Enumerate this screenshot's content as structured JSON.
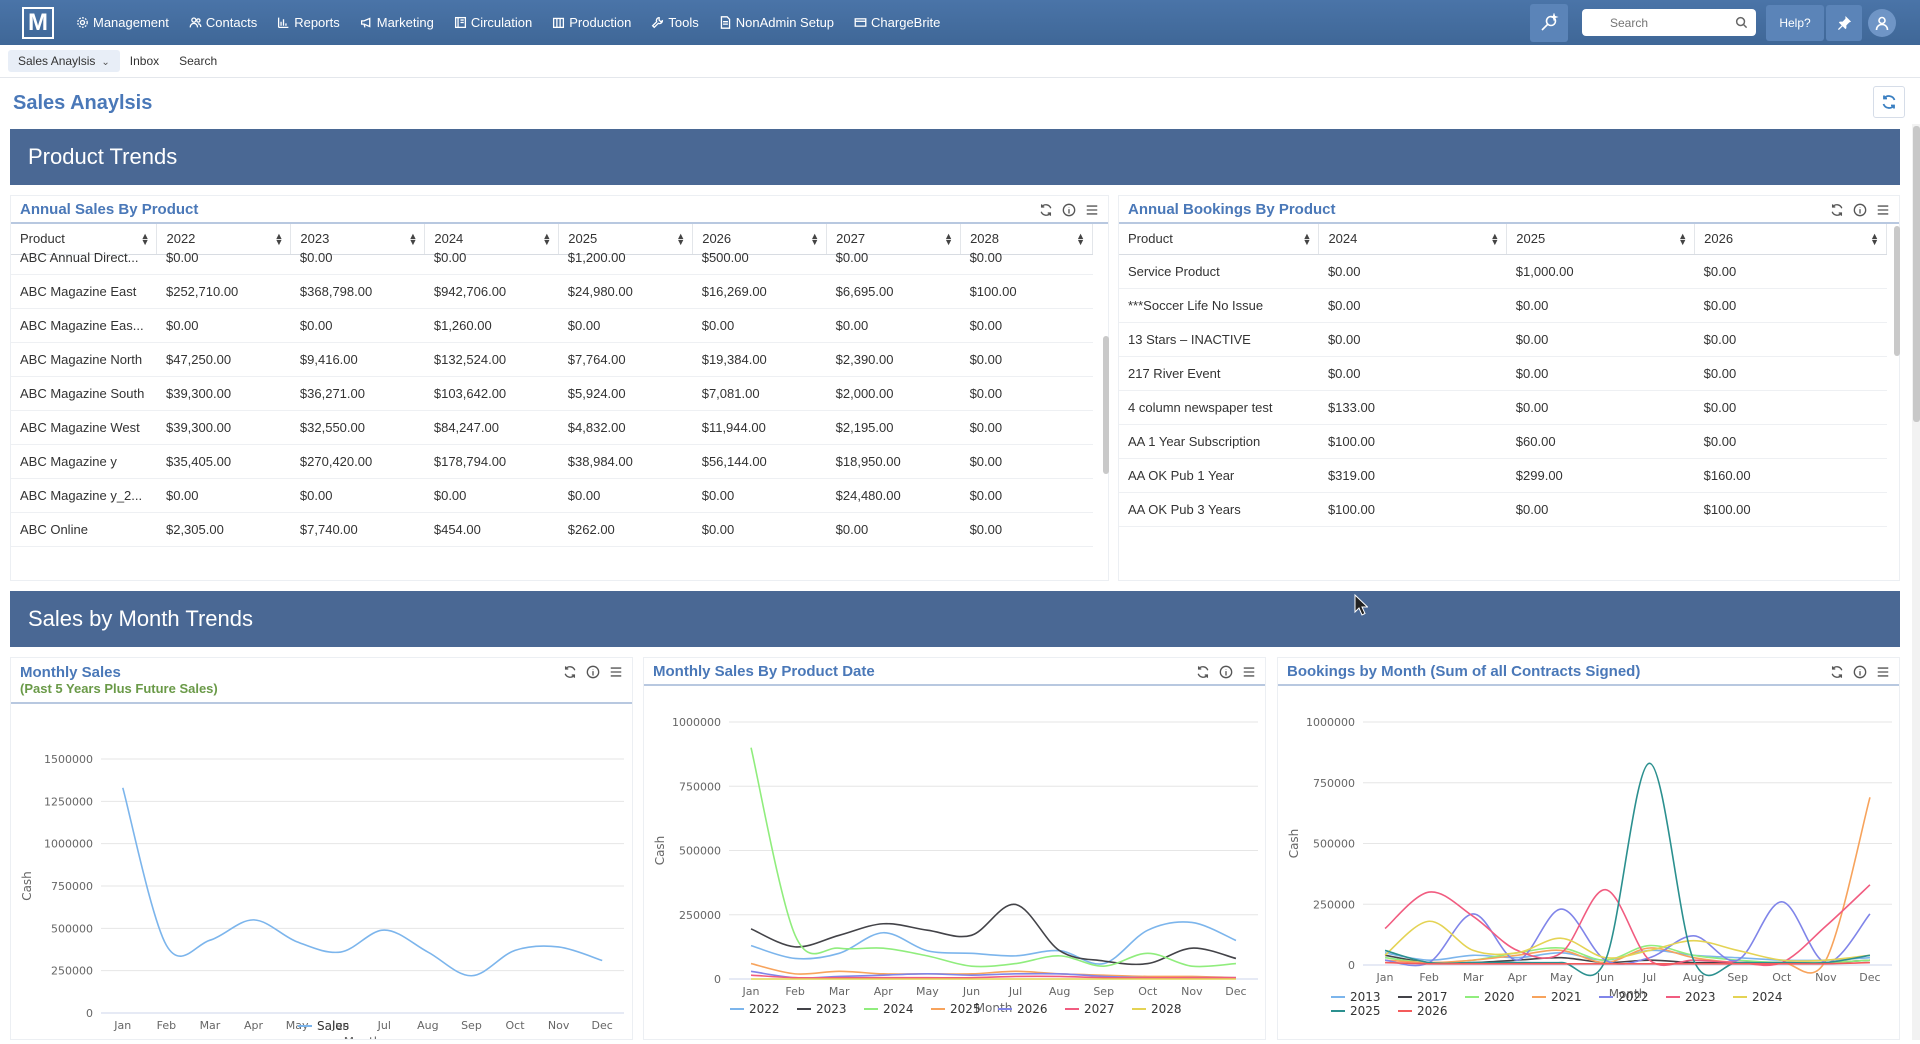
{
  "nav": {
    "logo": "M",
    "items": [
      {
        "label": "Management",
        "icon": "gear-icon"
      },
      {
        "label": "Contacts",
        "icon": "people-icon"
      },
      {
        "label": "Reports",
        "icon": "bar-chart-icon"
      },
      {
        "label": "Marketing",
        "icon": "megaphone-icon"
      },
      {
        "label": "Circulation",
        "icon": "book-icon"
      },
      {
        "label": "Production",
        "icon": "building-icon"
      },
      {
        "label": "Tools",
        "icon": "wrench-icon"
      },
      {
        "label": "NonAdmin Setup",
        "icon": "document-icon"
      },
      {
        "label": "ChargeBrite",
        "icon": "card-icon"
      }
    ],
    "search_placeholder": "Search",
    "help_label": "Help?"
  },
  "tabs": {
    "active": "Sales Anaylsis",
    "inbox": "Inbox",
    "search": "Search"
  },
  "page_title": "Sales Anaylsis",
  "sections": {
    "product_trends": "Product Trends",
    "sales_by_month": "Sales by Month Trends"
  },
  "annual_sales": {
    "title": "Annual Sales By Product",
    "columns": [
      "Product",
      "2022",
      "2023",
      "2024",
      "2025",
      "2026",
      "2027",
      "2028"
    ],
    "rows": [
      [
        "ABC Annual Direct...",
        "$0.00",
        "$0.00",
        "$0.00",
        "$1,200.00",
        "$500.00",
        "$0.00",
        "$0.00"
      ],
      [
        "ABC Magazine East",
        "$252,710.00",
        "$368,798.00",
        "$942,706.00",
        "$24,980.00",
        "$16,269.00",
        "$6,695.00",
        "$100.00"
      ],
      [
        "ABC Magazine Eas...",
        "$0.00",
        "$0.00",
        "$1,260.00",
        "$0.00",
        "$0.00",
        "$0.00",
        "$0.00"
      ],
      [
        "ABC Magazine North",
        "$47,250.00",
        "$9,416.00",
        "$132,524.00",
        "$7,764.00",
        "$19,384.00",
        "$2,390.00",
        "$0.00"
      ],
      [
        "ABC Magazine South",
        "$39,300.00",
        "$36,271.00",
        "$103,642.00",
        "$5,924.00",
        "$7,081.00",
        "$2,000.00",
        "$0.00"
      ],
      [
        "ABC Magazine West",
        "$39,300.00",
        "$32,550.00",
        "$84,247.00",
        "$4,832.00",
        "$11,944.00",
        "$2,195.00",
        "$0.00"
      ],
      [
        "ABC Magazine y",
        "$35,405.00",
        "$270,420.00",
        "$178,794.00",
        "$38,984.00",
        "$56,144.00",
        "$18,950.00",
        "$0.00"
      ],
      [
        "ABC Magazine y_2...",
        "$0.00",
        "$0.00",
        "$0.00",
        "$0.00",
        "$0.00",
        "$24,480.00",
        "$0.00"
      ],
      [
        "ABC Online",
        "$2,305.00",
        "$7,740.00",
        "$454.00",
        "$262.00",
        "$0.00",
        "$0.00",
        "$0.00"
      ]
    ]
  },
  "annual_bookings": {
    "title": "Annual Bookings By Product",
    "columns": [
      "Product",
      "2024",
      "2025",
      "2026"
    ],
    "rows": [
      [
        "Service Product",
        "$0.00",
        "$1,000.00",
        "$0.00"
      ],
      [
        "***Soccer Life No Issue",
        "$0.00",
        "$0.00",
        "$0.00"
      ],
      [
        "13 Stars – INACTIVE",
        "$0.00",
        "$0.00",
        "$0.00"
      ],
      [
        "217 River Event",
        "$0.00",
        "$0.00",
        "$0.00"
      ],
      [
        "4 column newspaper test",
        "$133.00",
        "$0.00",
        "$0.00"
      ],
      [
        "AA 1 Year Subscription",
        "$100.00",
        "$60.00",
        "$0.00"
      ],
      [
        "AA OK Pub 1 Year",
        "$319.00",
        "$299.00",
        "$160.00"
      ],
      [
        "AA OK Pub 3 Years",
        "$100.00",
        "$0.00",
        "$100.00"
      ]
    ]
  },
  "monthly_sales_panel": {
    "title": "Monthly Sales",
    "subtitle": "(Past 5 Years Plus Future Sales)"
  },
  "monthly_by_product_panel": {
    "title": "Monthly Sales By Product Date"
  },
  "bookings_by_month_panel": {
    "title": "Bookings by Month (Sum of all Contracts Signed)"
  },
  "chart_data": [
    {
      "type": "line",
      "xlabel": "Month",
      "ylabel": "Cash",
      "ylim": [
        0,
        1500000
      ],
      "yticks": [
        0,
        250000,
        500000,
        750000,
        1000000,
        1250000,
        1500000
      ],
      "categories": [
        "Jan",
        "Feb",
        "Mar",
        "Apr",
        "May",
        "Jun",
        "Jul",
        "Aug",
        "Sep",
        "Oct",
        "Nov",
        "Dec"
      ],
      "series": [
        {
          "name": "Sales",
          "color": "#7cb5ec",
          "values": [
            1330000,
            400000,
            430000,
            550000,
            420000,
            360000,
            490000,
            360000,
            220000,
            370000,
            390000,
            310000
          ]
        }
      ],
      "legend": "bottom-center",
      "grid": true
    },
    {
      "type": "line",
      "xlabel": "Month",
      "ylabel": "Cash",
      "ylim": [
        0,
        1000000
      ],
      "yticks": [
        0,
        250000,
        500000,
        750000,
        1000000
      ],
      "categories": [
        "Jan",
        "Feb",
        "Mar",
        "Apr",
        "May",
        "Jun",
        "Jul",
        "Aug",
        "Sep",
        "Oct",
        "Nov",
        "Dec"
      ],
      "series": [
        {
          "name": "2022",
          "color": "#7cb5ec",
          "values": [
            130000,
            80000,
            100000,
            180000,
            110000,
            100000,
            90000,
            110000,
            60000,
            190000,
            220000,
            150000
          ]
        },
        {
          "name": "2023",
          "color": "#434348",
          "values": [
            195000,
            125000,
            170000,
            215000,
            190000,
            170000,
            290000,
            110000,
            70000,
            60000,
            120000,
            80000
          ]
        },
        {
          "name": "2024",
          "color": "#90ed7d",
          "values": [
            900000,
            170000,
            120000,
            120000,
            90000,
            50000,
            60000,
            90000,
            50000,
            100000,
            50000,
            60000
          ]
        },
        {
          "name": "2025",
          "color": "#f7a35c",
          "values": [
            60000,
            20000,
            30000,
            20000,
            20000,
            20000,
            30000,
            20000,
            15000,
            10000,
            10000,
            5000
          ]
        },
        {
          "name": "2026",
          "color": "#8085e9",
          "values": [
            30000,
            5000,
            10000,
            15000,
            20000,
            15000,
            20000,
            20000,
            10000,
            5000,
            5000,
            5000
          ]
        },
        {
          "name": "2027",
          "color": "#f15c80",
          "values": [
            15000,
            5000,
            5000,
            5000,
            5000,
            5000,
            10000,
            10000,
            5000,
            5000,
            5000,
            5000
          ]
        },
        {
          "name": "2028",
          "color": "#e4d354",
          "values": [
            0,
            0,
            0,
            0,
            0,
            0,
            0,
            0,
            0,
            0,
            0,
            0
          ]
        }
      ],
      "legend": "bottom-center",
      "grid": true
    },
    {
      "type": "line",
      "xlabel": "Month",
      "ylabel": "Cash",
      "ylim": [
        0,
        1000000
      ],
      "yticks": [
        0,
        250000,
        500000,
        750000,
        1000000
      ],
      "categories": [
        "Jan",
        "Feb",
        "Mar",
        "Apr",
        "May",
        "Jun",
        "Jul",
        "Aug",
        "Sep",
        "Oct",
        "Nov",
        "Dec"
      ],
      "series": [
        {
          "name": "2013",
          "color": "#7cb5ec",
          "values": [
            50000,
            20000,
            40000,
            30000,
            50000,
            20000,
            60000,
            40000,
            30000,
            20000,
            20000,
            30000
          ]
        },
        {
          "name": "2017",
          "color": "#434348",
          "values": [
            40000,
            10000,
            10000,
            20000,
            30000,
            10000,
            20000,
            10000,
            10000,
            10000,
            10000,
            20000
          ]
        },
        {
          "name": "2020",
          "color": "#90ed7d",
          "values": [
            30000,
            10000,
            20000,
            50000,
            70000,
            20000,
            80000,
            40000,
            20000,
            10000,
            10000,
            20000
          ]
        },
        {
          "name": "2021",
          "color": "#f7a35c",
          "values": [
            20000,
            10000,
            20000,
            40000,
            60000,
            10000,
            70000,
            30000,
            10000,
            10000,
            20000,
            690000
          ]
        },
        {
          "name": "2022",
          "color": "#8085e9",
          "values": [
            20000,
            10000,
            210000,
            20000,
            230000,
            20000,
            30000,
            120000,
            20000,
            260000,
            10000,
            210000
          ]
        },
        {
          "name": "2023",
          "color": "#f15c80",
          "values": [
            150000,
            300000,
            200000,
            60000,
            50000,
            310000,
            20000,
            20000,
            10000,
            10000,
            160000,
            330000
          ]
        },
        {
          "name": "2024",
          "color": "#e4d354",
          "values": [
            40000,
            180000,
            60000,
            50000,
            110000,
            30000,
            60000,
            100000,
            60000,
            20000,
            20000,
            40000
          ]
        },
        {
          "name": "2025",
          "color": "#2b908f",
          "values": [
            60000,
            10000,
            10000,
            10000,
            10000,
            20000,
            830000,
            20000,
            10000,
            10000,
            10000,
            40000
          ]
        },
        {
          "name": "2026",
          "color": "#f45b5b",
          "values": [
            10000,
            5000,
            5000,
            5000,
            5000,
            5000,
            5000,
            5000,
            5000,
            5000,
            5000,
            10000
          ]
        }
      ],
      "legend": "bottom-left",
      "grid": true
    }
  ]
}
